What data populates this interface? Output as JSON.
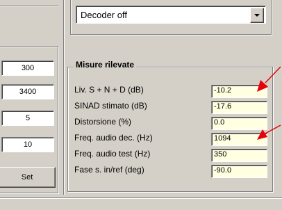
{
  "left_panel": {
    "fields": [
      "300",
      "3400",
      "5",
      "10"
    ],
    "set_button": "Set"
  },
  "decoder": {
    "selected": "Decoder off",
    "arrow_icon": "chevron-down-icon"
  },
  "measurements": {
    "title": "Misure rilevate",
    "rows": [
      {
        "label": "Liv. S + N + D  (dB)",
        "value": "-10.2"
      },
      {
        "label": "SINAD stimato (dB)",
        "value": "-17.6"
      },
      {
        "label": "Distorsione  (%)",
        "value": "0.0"
      },
      {
        "label": "Freq. audio dec. (Hz)",
        "value": "1094"
      },
      {
        "label": "Freq. audio test  (Hz)",
        "value": "350"
      },
      {
        "label": "Fase s. in/ref (deg)",
        "value": "-90.0"
      }
    ]
  },
  "annotations": {
    "arrow_color": "#e8000b",
    "value_bg": "#ffffe1",
    "window_bg": "#d4d0c8"
  }
}
